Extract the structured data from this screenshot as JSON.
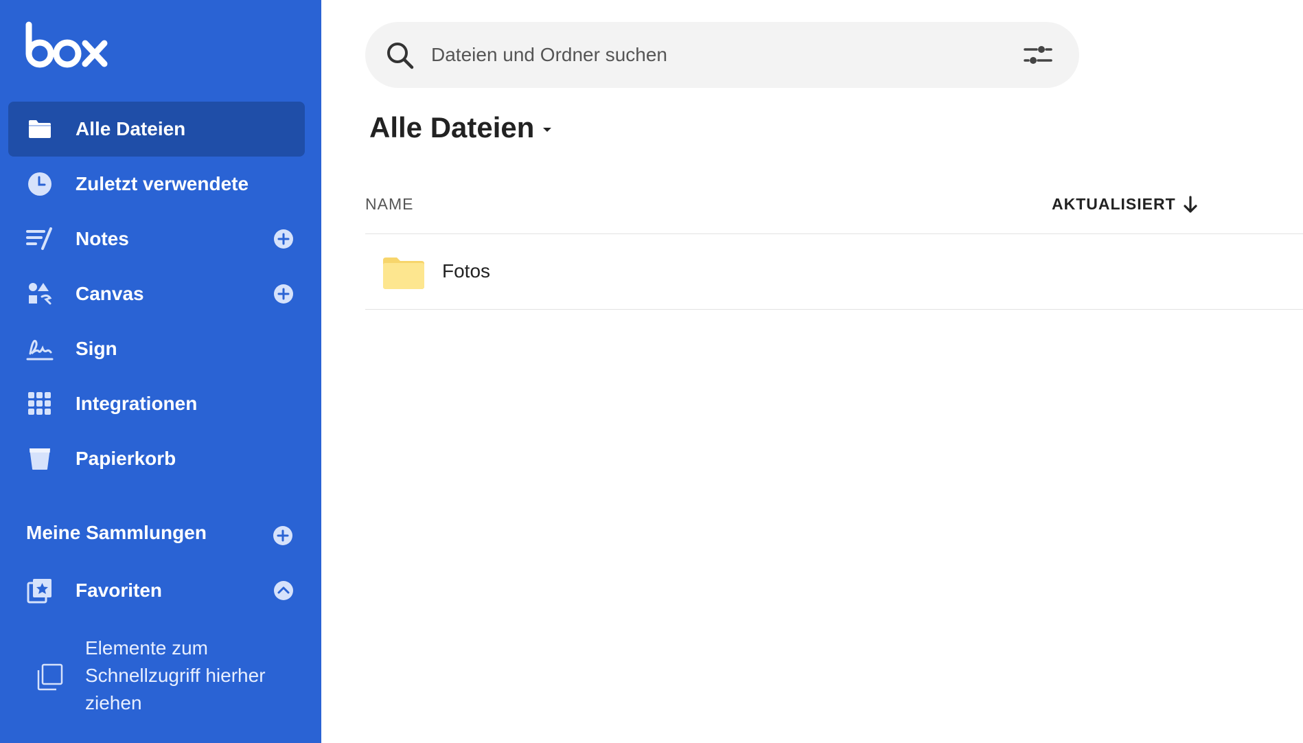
{
  "app": {
    "logo_text": "box"
  },
  "sidebar": {
    "items": [
      {
        "label": "Alle Dateien",
        "icon": "folder-icon",
        "active": true,
        "has_add": false
      },
      {
        "label": "Zuletzt verwendete",
        "icon": "clock-icon",
        "active": false,
        "has_add": false
      },
      {
        "label": "Notes",
        "icon": "notes-icon",
        "active": false,
        "has_add": true
      },
      {
        "label": "Canvas",
        "icon": "canvas-icon",
        "active": false,
        "has_add": true
      },
      {
        "label": "Sign",
        "icon": "signature-icon",
        "active": false,
        "has_add": false
      },
      {
        "label": "Integrationen",
        "icon": "grid-icon",
        "active": false,
        "has_add": false
      },
      {
        "label": "Papierkorb",
        "icon": "trash-icon",
        "active": false,
        "has_add": false
      }
    ],
    "collections": {
      "title": "Meine Sammlungen",
      "favorites_label": "Favoriten",
      "drop_hint": "Elemente zum Schnellzugriff hierher ziehen"
    }
  },
  "search": {
    "placeholder": "Dateien und Ordner suchen",
    "value": ""
  },
  "main": {
    "title": "Alle Dateien",
    "columns": {
      "name": "NAME",
      "updated": "AKTUALISIERT"
    },
    "files": [
      {
        "name": "Fotos",
        "type": "folder"
      }
    ]
  },
  "colors": {
    "sidebar_bg": "#2a63d4",
    "sidebar_active": "#1f4ea8",
    "folder": "#fde68f",
    "search_bg": "#f3f3f3"
  }
}
